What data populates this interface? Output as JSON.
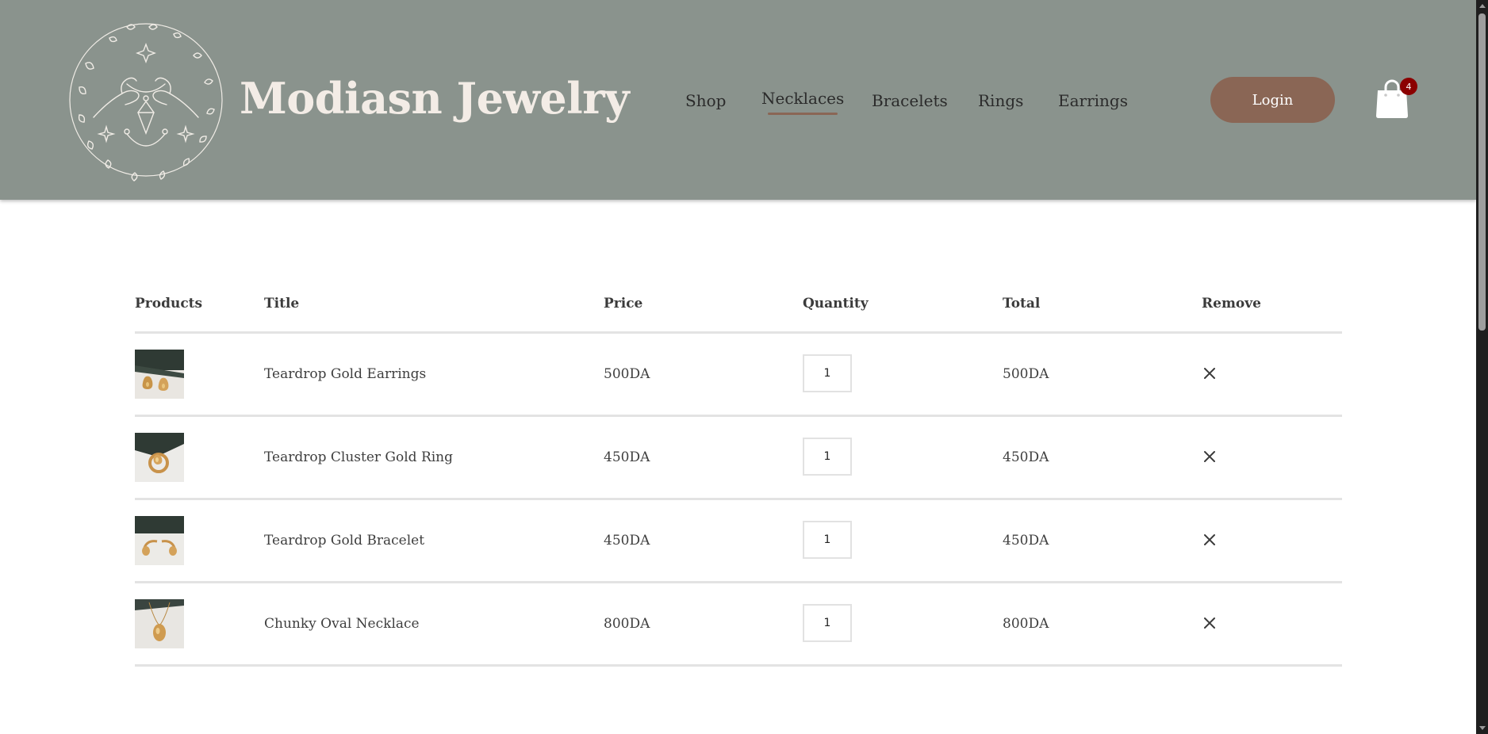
{
  "brand": {
    "name": "Modiasn Jewelry"
  },
  "nav": {
    "items": [
      {
        "label": "Shop",
        "active": false
      },
      {
        "label": "Necklaces",
        "active": true
      },
      {
        "label": "Bracelets",
        "active": false
      },
      {
        "label": "Rings",
        "active": false
      },
      {
        "label": "Earrings",
        "active": false
      }
    ],
    "login_label": "Login",
    "cart_count": "4"
  },
  "table": {
    "headers": {
      "products": "Products",
      "title": "Title",
      "price": "Price",
      "quantity": "Quantity",
      "total": "Total",
      "remove": "Remove"
    },
    "rows": [
      {
        "title": "Teardrop Gold Earrings",
        "price": "500DA",
        "quantity": "1",
        "total": "500DA",
        "image": "earrings-photo"
      },
      {
        "title": "Teardrop Cluster Gold Ring",
        "price": "450DA",
        "quantity": "1",
        "total": "450DA",
        "image": "ring-photo"
      },
      {
        "title": "Teardrop Gold Bracelet",
        "price": "450DA",
        "quantity": "1",
        "total": "450DA",
        "image": "bracelet-photo"
      },
      {
        "title": "Chunky Oval Necklace",
        "price": "800DA",
        "quantity": "1",
        "total": "800DA",
        "image": "necklace-photo"
      }
    ]
  },
  "colors": {
    "header_bg": "#8a938d",
    "accent": "#8a6655",
    "badge": "#8b0000",
    "brand_text": "#f3ece6"
  }
}
